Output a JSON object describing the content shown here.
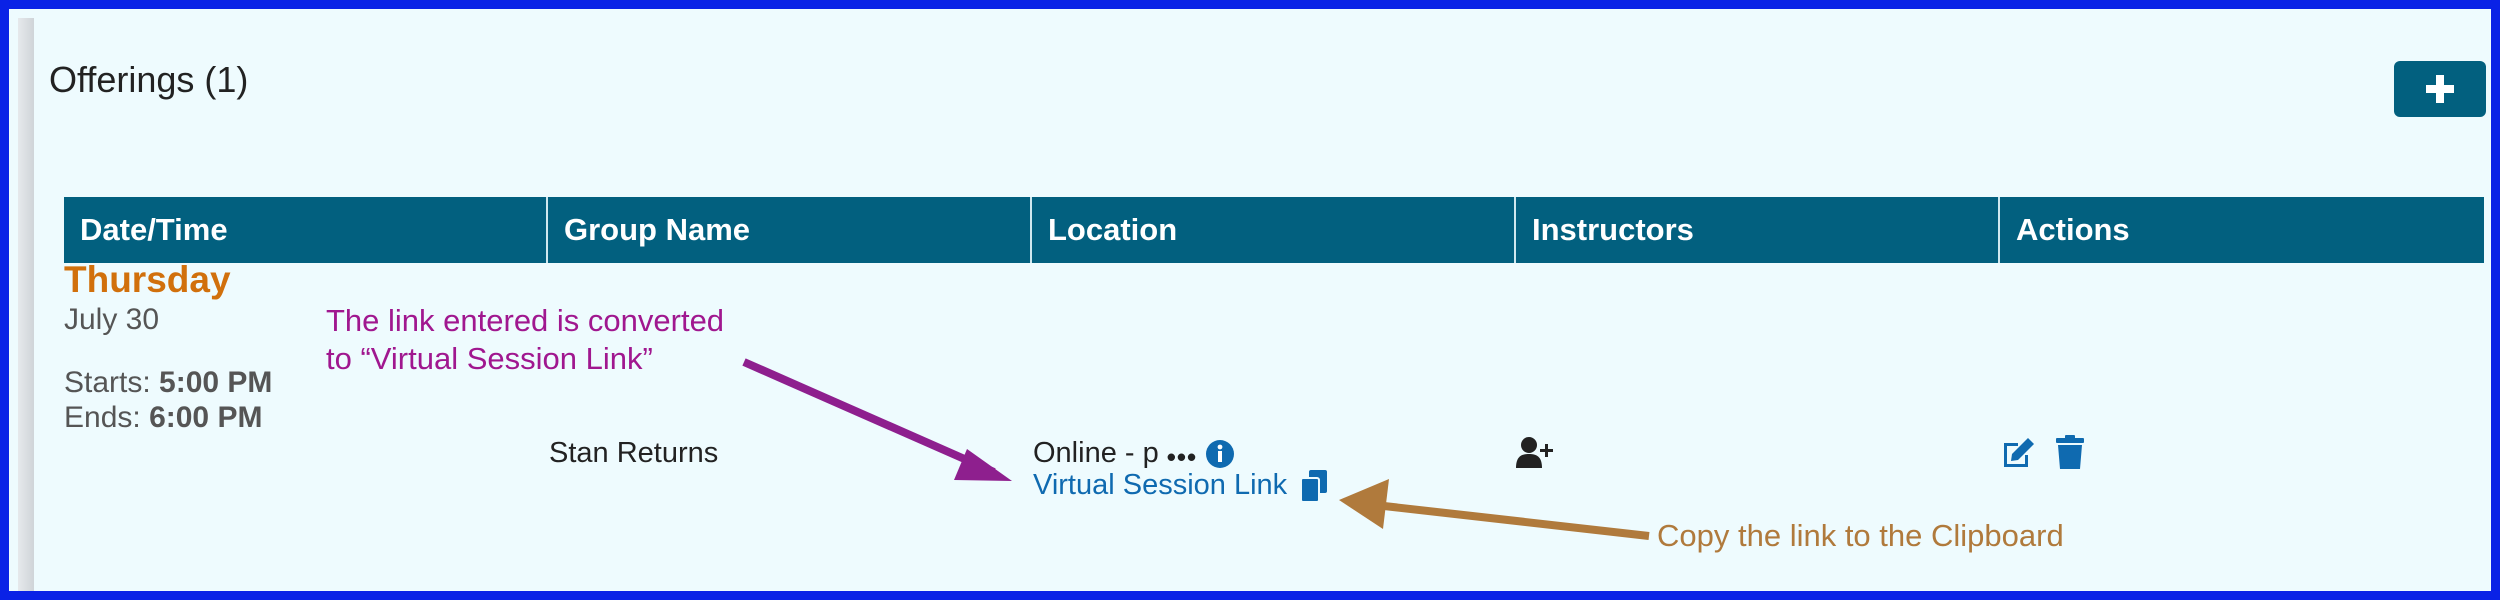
{
  "section": {
    "title": "Offerings (1)"
  },
  "add_button": {
    "icon": "plus-icon"
  },
  "table": {
    "headers": [
      "Date/Time",
      "Group Name",
      "Location",
      "Instructors",
      "Actions"
    ]
  },
  "row": {
    "day": "Thursday",
    "date": "July 30",
    "starts_label": "Starts: ",
    "starts_time": "5:00 PM",
    "ends_label": "Ends: ",
    "ends_time": "6:00 PM",
    "group_name": "Stan Returns",
    "location_text": "Online - p",
    "location_ellipsis": "•••",
    "virtual_link": "Virtual Session Link",
    "icons": [
      "info-icon",
      "copy-icon",
      "add-instructor-icon",
      "edit-icon",
      "trash-icon"
    ]
  },
  "annotations": {
    "note_convert_line1": "The link entered is converted",
    "note_convert_line2": "to “Virtual Session Link”",
    "note_copy": "Copy the link to the Clipboard"
  },
  "colors": {
    "border": "#0a22e6",
    "header_bg": "#02607f",
    "day": "#d1700c",
    "link": "#0f6ab0",
    "annotation_purple": "#a0178f",
    "annotation_brown": "#b07a3c"
  }
}
